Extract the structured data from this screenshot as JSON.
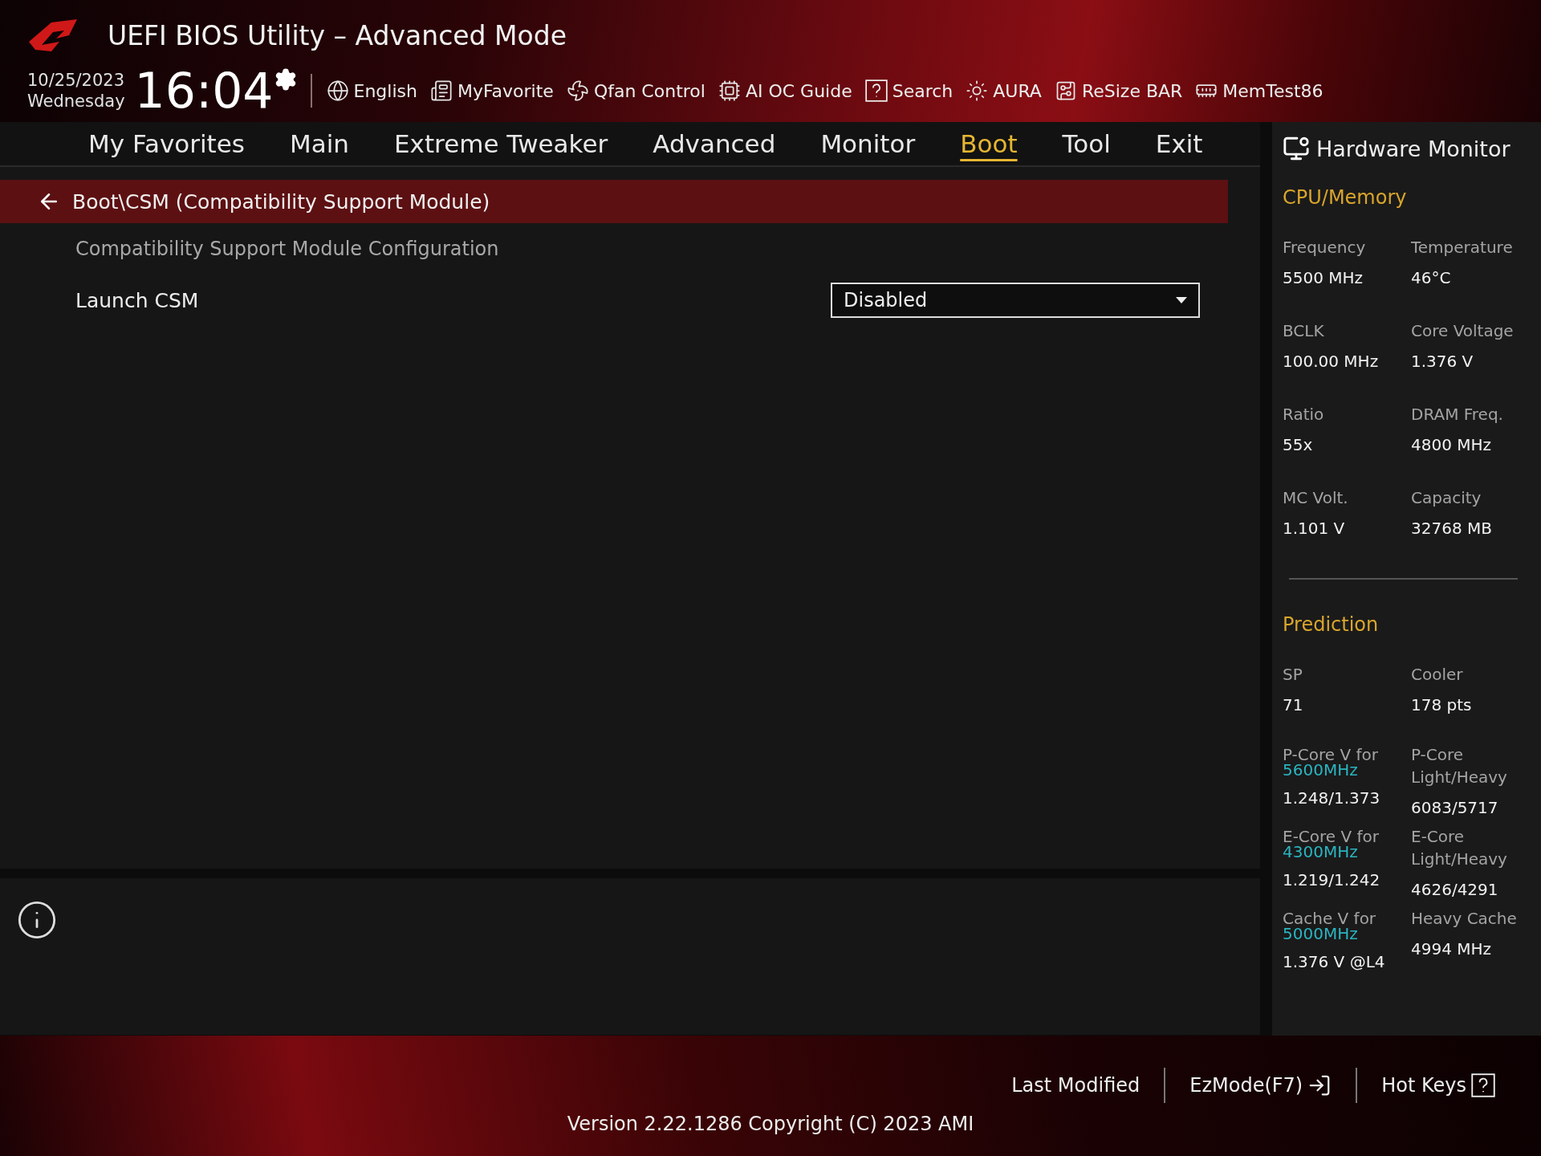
{
  "header": {
    "title": "UEFI BIOS Utility – Advanced Mode",
    "date": "10/25/2023",
    "weekday": "Wednesday",
    "time": "16:04",
    "tools": [
      {
        "label": "English",
        "kind": "language"
      },
      {
        "label": "MyFavorite",
        "kind": "favorite"
      },
      {
        "label": "Qfan Control",
        "kind": "fan"
      },
      {
        "label": "AI OC Guide",
        "kind": "guide"
      },
      {
        "label": "Search",
        "kind": "search"
      },
      {
        "label": "AURA",
        "kind": "aura"
      },
      {
        "label": "ReSize BAR",
        "kind": "card"
      },
      {
        "label": "MemTest86",
        "kind": "memory"
      }
    ]
  },
  "tabs": [
    {
      "label": "My Favorites",
      "selected": false
    },
    {
      "label": "Main",
      "selected": false
    },
    {
      "label": "Extreme Tweaker",
      "selected": false
    },
    {
      "label": "Advanced",
      "selected": false
    },
    {
      "label": "Monitor",
      "selected": false
    },
    {
      "label": "Boot",
      "selected": true
    },
    {
      "label": "Tool",
      "selected": false
    },
    {
      "label": "Exit",
      "selected": false
    }
  ],
  "breadcrumb": "Boot\\CSM (Compatibility Support Module)",
  "section_title": "Compatibility Support Module Configuration",
  "settings": [
    {
      "label": "Launch CSM",
      "value": "Disabled"
    }
  ],
  "hardware_monitor": {
    "title": "Hardware Monitor",
    "sections": [
      {
        "title": "CPU/Memory",
        "items": [
          {
            "label": "Frequency",
            "value": "5500 MHz"
          },
          {
            "label": "Temperature",
            "value": "46°C"
          },
          {
            "label": "BCLK",
            "value": "100.00 MHz"
          },
          {
            "label": "Core Voltage",
            "value": "1.376 V"
          },
          {
            "label": "Ratio",
            "value": "55x"
          },
          {
            "label": "DRAM Freq.",
            "value": "4800 MHz"
          },
          {
            "label": "MC Volt.",
            "value": "1.101 V"
          },
          {
            "label": "Capacity",
            "value": "32768 MB"
          }
        ]
      },
      {
        "title": "Prediction",
        "items": [
          {
            "label": "SP",
            "value": "71"
          },
          {
            "label": "Cooler",
            "value": "178 pts"
          },
          {
            "label": "P-Core V for",
            "accent": "5600MHz",
            "value": "1.248/1.373"
          },
          {
            "label": "P-Core Light/Heavy",
            "value": "6083/5717"
          },
          {
            "label": "E-Core V for",
            "accent": "4300MHz",
            "value": "1.219/1.242"
          },
          {
            "label": "E-Core Light/Heavy",
            "value": "4626/4291"
          },
          {
            "label": "Cache V for",
            "accent": "5000MHz",
            "value": "1.376 V @L4"
          },
          {
            "label": "Heavy Cache",
            "value": "4994 MHz"
          }
        ]
      }
    ]
  },
  "footer": {
    "buttons": [
      {
        "label": "Last Modified",
        "kind": "plain"
      },
      {
        "label": "EzMode(F7)",
        "kind": "exit"
      },
      {
        "label": "Hot Keys",
        "kind": "help"
      }
    ],
    "version": "Version 2.22.1286 Copyright (C) 2023 AMI"
  }
}
